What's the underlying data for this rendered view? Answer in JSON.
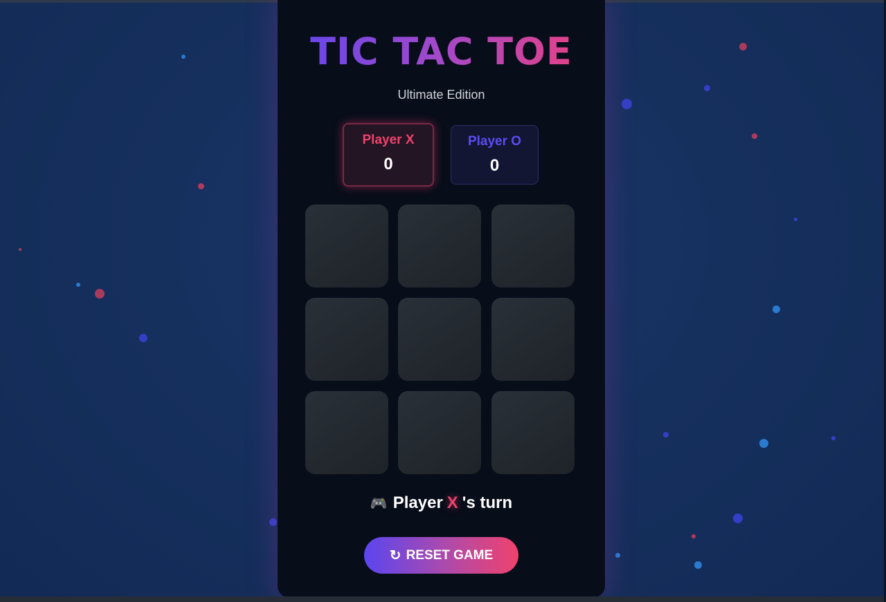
{
  "game": {
    "title": "TIC TAC TOE",
    "subtitle": "Ultimate Edition"
  },
  "scores": {
    "x": {
      "label": "Player X",
      "value": "0"
    },
    "o": {
      "label": "Player O",
      "value": "0"
    }
  },
  "board": {
    "cells": [
      "",
      "",
      "",
      "",
      "",
      "",
      "",
      "",
      ""
    ]
  },
  "status": {
    "icon": "gamepad-icon",
    "icon_glyph": "🎮",
    "prefix": "Player",
    "current_mark": "X",
    "suffix": "'s turn"
  },
  "reset_button": {
    "icon": "refresh-icon",
    "icon_glyph": "↻",
    "label": "RESET GAME"
  },
  "colors": {
    "accent_x": "#f0426d",
    "accent_o": "#5b4cf2",
    "background": "#16305e",
    "card": "#070d19"
  }
}
